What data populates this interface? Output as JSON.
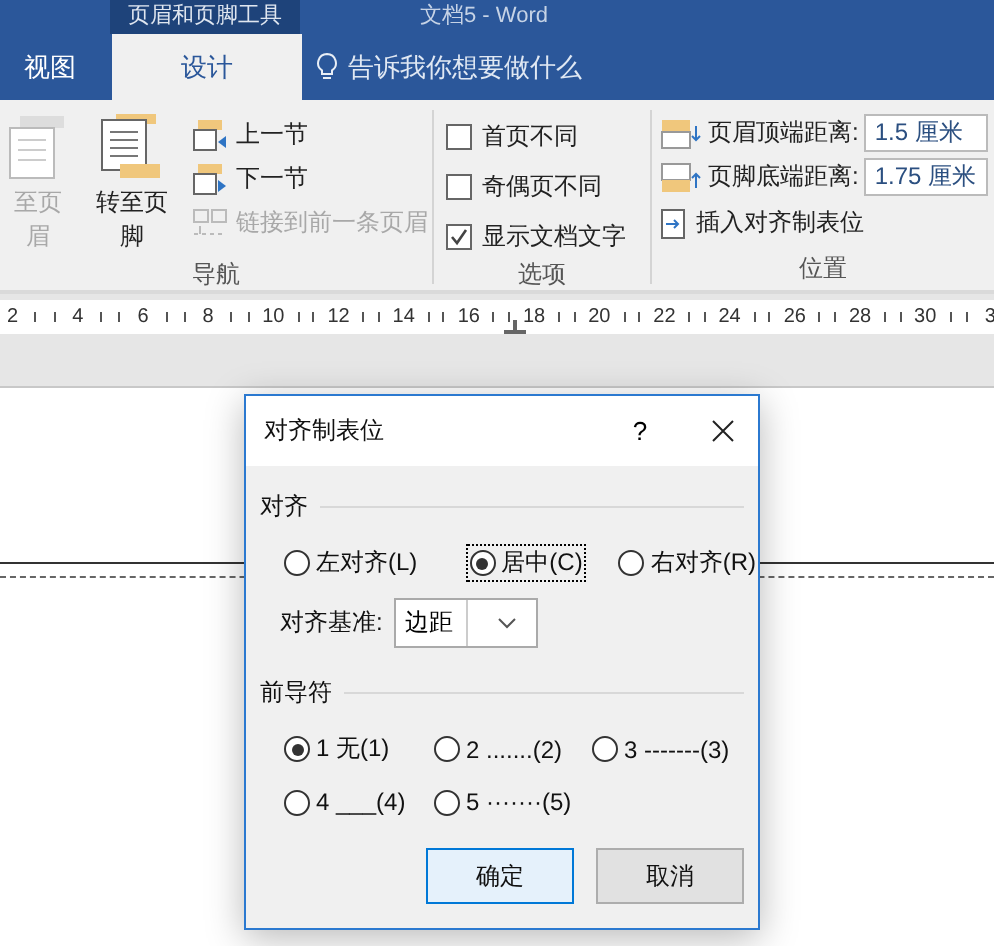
{
  "title_bar": {
    "context_tab": "页眉和页脚工具",
    "document_title": "文档5 - Word"
  },
  "tabs": [
    {
      "label": "视图",
      "selected": false
    },
    {
      "label": "设计",
      "selected": true
    }
  ],
  "tell_me": {
    "label": "告诉我你想要做什么"
  },
  "navigation": {
    "label": "导航",
    "items": [
      {
        "kind": "goto-header",
        "label": "至页眉",
        "disabled": true
      },
      {
        "kind": "goto-footer",
        "label": "转至页脚",
        "disabled": false
      },
      {
        "kind": "previous",
        "label": "上一节",
        "disabled": false
      },
      {
        "kind": "next",
        "label": "下一节",
        "disabled": false
      },
      {
        "kind": "link",
        "label": "链接到前一条页眉",
        "disabled": true
      }
    ]
  },
  "options": {
    "label": "选项",
    "checkboxes": [
      {
        "label": "首页不同",
        "checked": false
      },
      {
        "label": "奇偶页不同",
        "checked": false
      },
      {
        "label": "显示文档文字",
        "checked": true
      }
    ]
  },
  "position": {
    "label": "位置",
    "fields": [
      {
        "kind": "header",
        "label": "页眉顶端距离:",
        "value": "1.5 厘米"
      },
      {
        "kind": "footer",
        "label": "页脚底端距离:",
        "value": "1.75 厘米"
      }
    ],
    "insert_tab": "插入对齐制表位"
  },
  "ruler": {
    "labels": [
      "2",
      "4",
      "6",
      "8",
      "10",
      "12",
      "14",
      "16",
      "18",
      "20",
      "22",
      "24",
      "26",
      "28",
      "30",
      "3"
    ]
  },
  "dialog": {
    "title": "对齐制表位",
    "help": "?",
    "alignment": {
      "label": "对齐",
      "options": [
        {
          "label": "左对齐(L)",
          "selected": false,
          "focused": false
        },
        {
          "label": "居中(C)",
          "selected": true,
          "focused": true
        },
        {
          "label": "右对齐(R)",
          "selected": false,
          "focused": false
        }
      ],
      "basis": {
        "label": "对齐基准:",
        "value": "边距"
      }
    },
    "leader": {
      "label": "前导符",
      "options": [
        {
          "label": "1 无(1)",
          "selected": true
        },
        {
          "label": "2 .......(2)",
          "selected": false
        },
        {
          "label": "3 -------(3)",
          "selected": false
        },
        {
          "label": "4 ___(4)",
          "selected": false
        },
        {
          "label": "5 ·······(5)",
          "selected": false
        }
      ]
    },
    "buttons": [
      {
        "label": "确定",
        "default": true
      },
      {
        "label": "取消",
        "default": false
      }
    ]
  }
}
